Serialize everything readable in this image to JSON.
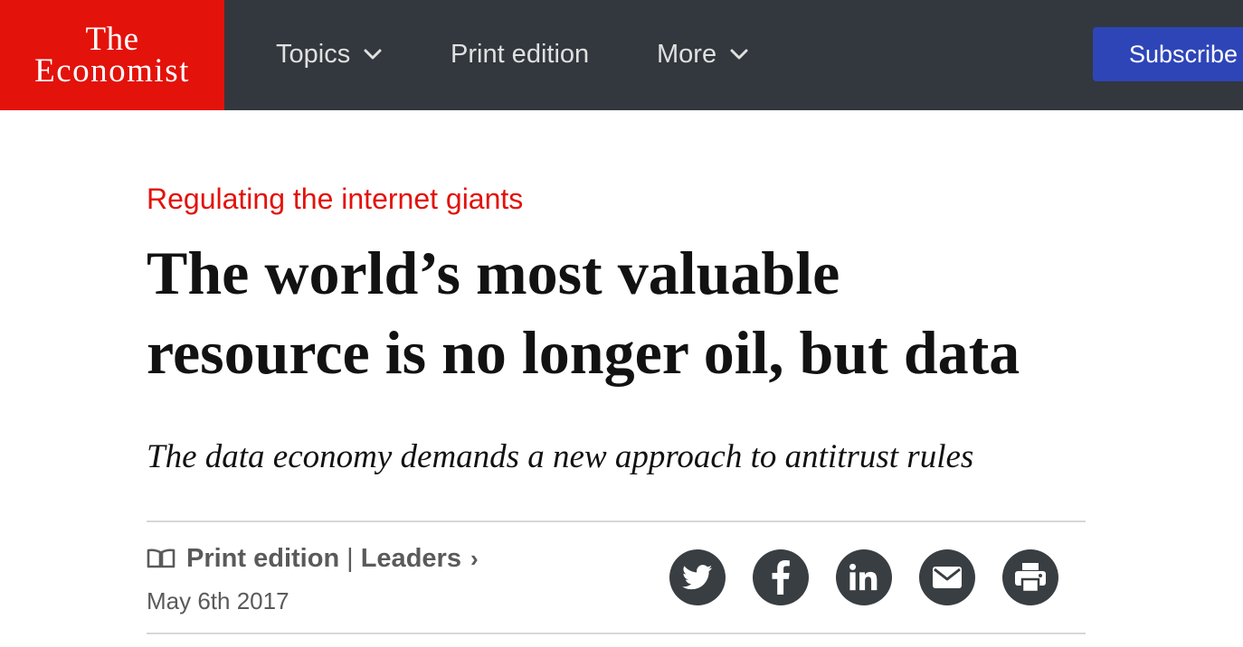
{
  "nav": {
    "logo": {
      "line1": "The",
      "line2": "Economist"
    },
    "items": [
      {
        "label": "Topics",
        "has_dropdown": true
      },
      {
        "label": "Print edition",
        "has_dropdown": false
      },
      {
        "label": "More",
        "has_dropdown": true
      }
    ],
    "subscribe_label": "Subscribe"
  },
  "article": {
    "fly_title": "Regulating the internet giants",
    "headline_line1": "The world’s most valuable",
    "headline_line2": "resource is no longer oil, but data",
    "rubric": "The data economy demands a new approach to antitrust rules",
    "section_link": "Print edition",
    "section_separator": "|",
    "section_name": "Leaders",
    "section_chevron": "›",
    "date": "May 6th 2017"
  },
  "share": [
    {
      "icon": "twitter-icon"
    },
    {
      "icon": "facebook-icon"
    },
    {
      "icon": "linkedin-icon"
    },
    {
      "icon": "email-icon"
    },
    {
      "icon": "print-icon"
    }
  ],
  "colors": {
    "brand_red": "#e3120b",
    "nav_bg": "#32383d",
    "subscribe_blue": "#2e45b8",
    "share_bg": "#383e42"
  }
}
